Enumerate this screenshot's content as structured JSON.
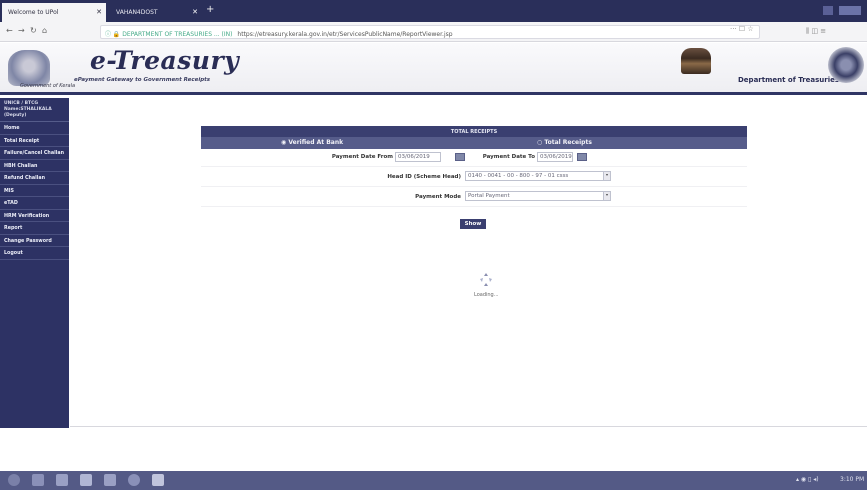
{
  "browser": {
    "tabs": [
      {
        "label": "Welcome to UPol",
        "active": true
      },
      {
        "label": "VAHAN4DOST",
        "active": false
      }
    ],
    "new_tab": "+",
    "url_prefix": "ⓘ 🔒 DEPARTMENT OF TREASURIES ... (IN)",
    "url": "https://etreasury.kerala.gov.in/etr/ServicesPublicName/ReportViewer.jsp"
  },
  "banner": {
    "brand": "e-Treasury",
    "tagline": "ePayment Gateway to Government Receipts",
    "emblem_caption": "Government of Kerala",
    "department": "Department of Treasuries"
  },
  "sidebar": {
    "user_block": [
      "UNICB / BTCG",
      "Name:STHALIKALA",
      "(Deputy)"
    ],
    "items": [
      "Home",
      "Total Receipt",
      "Failure/Cancel Challan",
      "HBH Challan",
      "Refund Challan",
      "MIS",
      "eTAD",
      "HRM Verification",
      "Report",
      "Change Password",
      "Logout"
    ]
  },
  "form": {
    "title": "TOTAL RECEIPTS",
    "radio_verified": "◉ Verified At Bank",
    "radio_total": "○ Total Receipts",
    "payment_date_from_label": "Payment Date From",
    "payment_date_from_value": "03/06/2019",
    "payment_date_to_label": "Payment Date To",
    "payment_date_to_value": "03/06/2019",
    "head_id_label": "Head ID (Scheme Head)",
    "head_id_value": "0140 - 0041 - 00 - 800 - 97 - 01 csss",
    "payment_mode_label": "Payment Mode",
    "payment_mode_value": "Portal Payment",
    "show_button": "Show"
  },
  "loading": {
    "text": "Loading..."
  },
  "taskbar": {
    "time": "3:10 PM"
  }
}
